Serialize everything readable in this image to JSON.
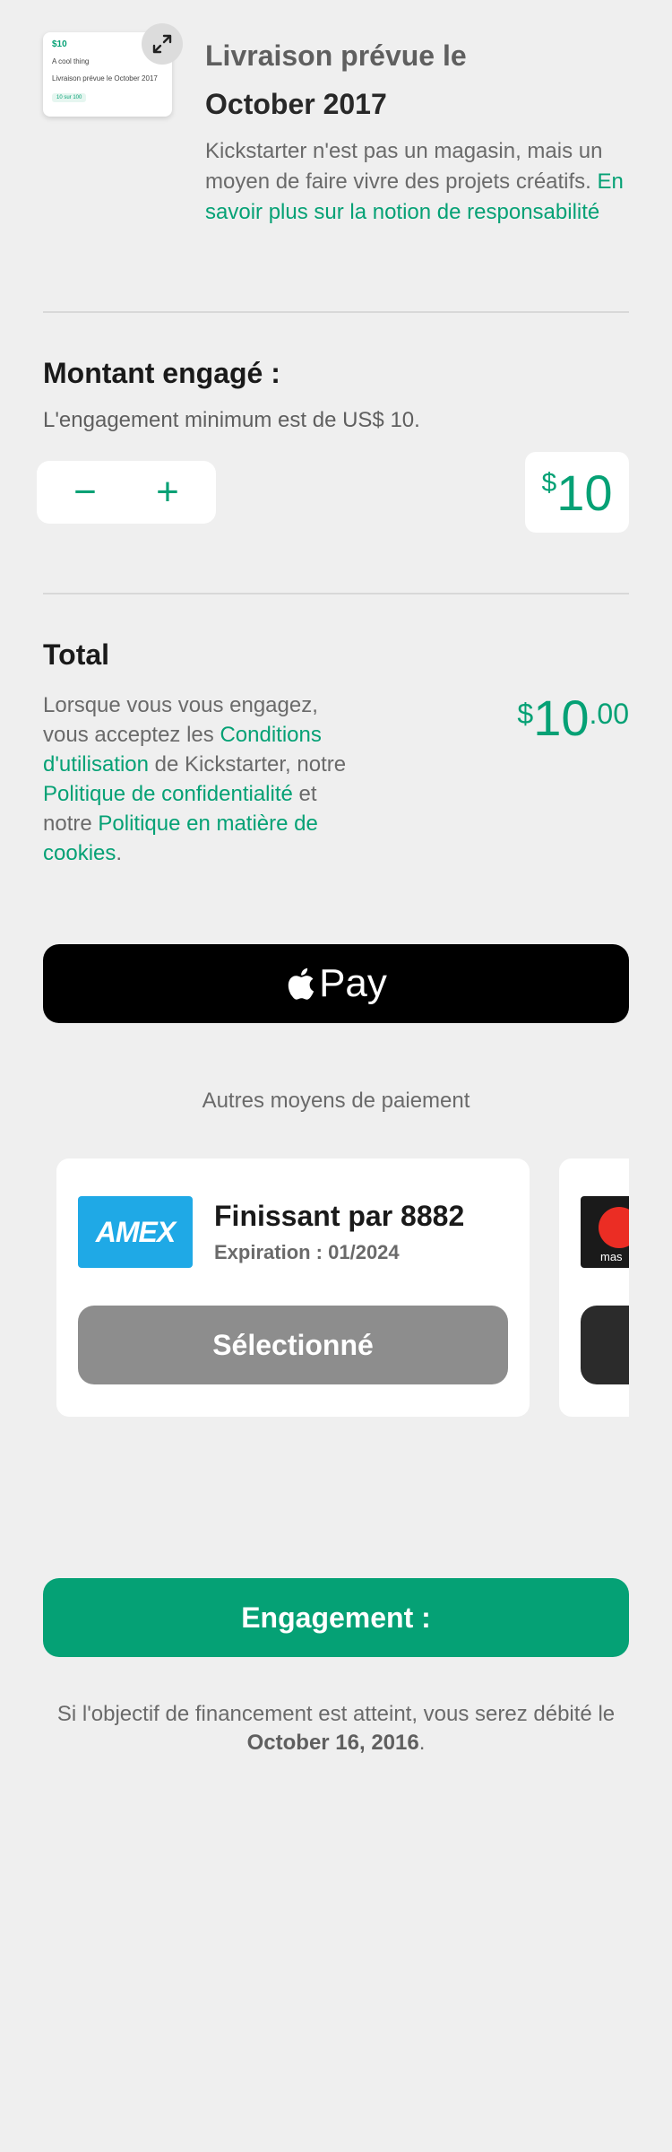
{
  "reward_thumb": {
    "amount": "$10",
    "title": "A cool thing",
    "shipping": "Livraison prévue le October 2017",
    "badge": "10 sur 100"
  },
  "icons": {
    "expand": "expand-arrows-icon",
    "apple": "apple-logo-icon"
  },
  "shipping": {
    "label": "Livraison prévue le",
    "date": "October 2017",
    "description": "Kickstarter n'est pas un magasin, mais un moyen de faire vivre des projets créatifs.",
    "link": "En savoir plus sur la notion de responsabilité"
  },
  "pledge": {
    "title": "Montant engagé :",
    "minimum": "L'engagement minimum est de US$ 10.",
    "decrement": "−",
    "increment": "+",
    "currency_symbol": "$",
    "amount": "10"
  },
  "total": {
    "title": "Total",
    "desc_1": "Lorsque vous vous engagez, vous acceptez les",
    "terms_link": "Conditions d'utilisation",
    "desc_2": "de Kickstarter, notre",
    "privacy_link": "Politique de confidentialité",
    "desc_3": "et notre",
    "cookie_link": "Politique en matière de cookies",
    "desc_4": ".",
    "currency_symbol": "$",
    "amount": "10",
    "cents": ".00"
  },
  "apple_pay": {
    "label": "Pay"
  },
  "other_methods": {
    "label": "Autres moyens de paiement"
  },
  "cards": [
    {
      "brand": "AMEX",
      "ending": "Finissant par 8882",
      "expiration": "Expiration : 01/2024",
      "button": "Sélectionné"
    },
    {
      "brand_text": "mas"
    }
  ],
  "submit": {
    "label": "Engagement :"
  },
  "footnote": {
    "text": "Si l'objectif de financement est atteint, vous serez débité le",
    "date": "October 16, 2016",
    "end": "."
  },
  "colors": {
    "accent": "#05a175",
    "background": "#efefef",
    "selected_button": "#8d8d8d",
    "amex_blue": "#1fa9e6"
  }
}
